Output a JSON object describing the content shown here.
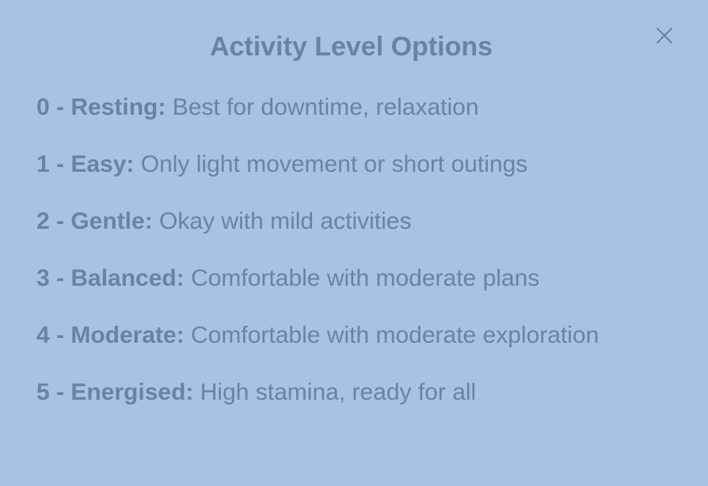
{
  "dialog": {
    "title": "Activity Level Options",
    "close_icon": "close-icon"
  },
  "options": [
    {
      "level": "0 - Resting:",
      "description": "Best for downtime, relaxation"
    },
    {
      "level": "1 - Easy:",
      "description": "Only light movement or short outings"
    },
    {
      "level": "2 - Gentle:",
      "description": "Okay with mild activities"
    },
    {
      "level": "3 - Balanced:",
      "description": "Comfortable with moderate plans"
    },
    {
      "level": "4 - Moderate:",
      "description": "Comfortable with moderate exploration"
    },
    {
      "level": "5 - Energised:",
      "description": "High stamina, ready for all"
    }
  ],
  "colors": {
    "background": "#a7c3e2",
    "text": "#6784a6"
  }
}
